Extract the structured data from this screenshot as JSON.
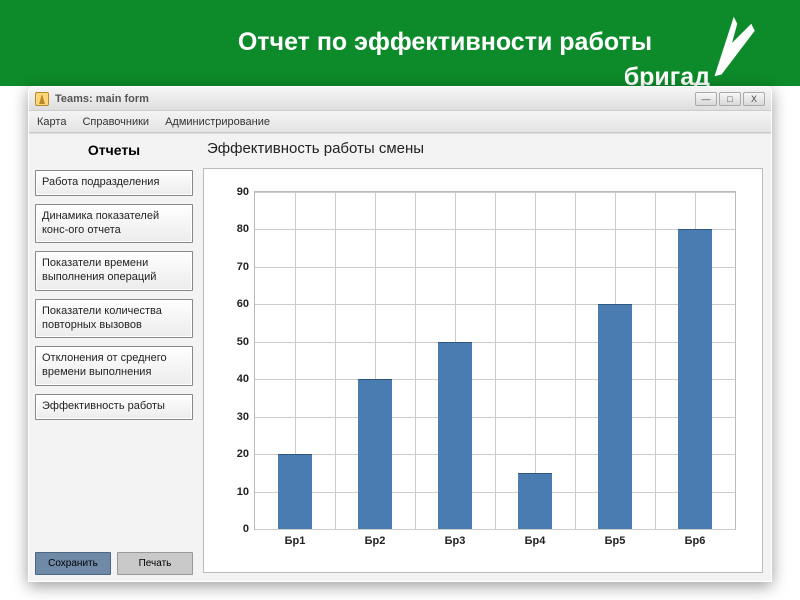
{
  "banner": {
    "title": "Отчет по эффективности работы",
    "subtitle": "бригад"
  },
  "window": {
    "title": "Teams: main form",
    "minimize": "—",
    "maximize": "□",
    "close": "X"
  },
  "menubar": {
    "items": [
      "Карта",
      "Справочники",
      "Администрирование"
    ]
  },
  "sidebar": {
    "title": "Отчеты",
    "reports": [
      "Работа подразделения",
      "Динамика показателей конс-ого отчета",
      "Показатели времени выполнения операций",
      "Показатели количества повторных вызовов",
      "Отклонения от среднего времени выполнения",
      "Эффективность работы"
    ],
    "save": "Сохранить",
    "print": "Печать"
  },
  "chart_title": "Эффективность работы смены",
  "chart_data": {
    "type": "bar",
    "categories": [
      "Бр1",
      "Бр2",
      "Бр3",
      "Бр4",
      "Бр5",
      "Бр6"
    ],
    "values": [
      20,
      40,
      50,
      15,
      60,
      80
    ],
    "title": "Эффективность работы смены",
    "xlabel": "",
    "ylabel": "",
    "ylim": [
      0,
      90
    ],
    "yticks": [
      0,
      10,
      20,
      30,
      40,
      50,
      60,
      70,
      80,
      90
    ]
  }
}
